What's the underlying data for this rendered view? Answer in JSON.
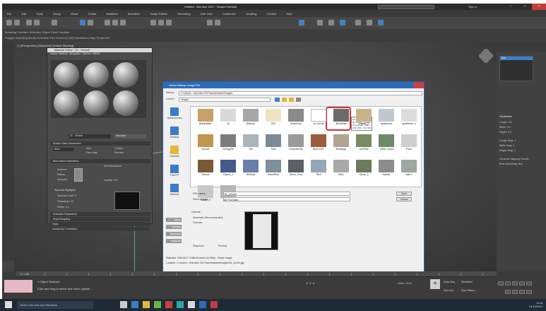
{
  "app": {
    "title": "Untitled - 3ds Max 2017 - Student Version",
    "user": "Sign In",
    "menu": [
      "File",
      "Edit",
      "Tools",
      "Group",
      "Views",
      "Create",
      "Modifiers",
      "Animation",
      "Graph Editors",
      "Rendering",
      "Civil View",
      "Customize",
      "Scripting",
      "Content",
      "Help"
    ],
    "ribbon_row1": "Modeling   Freeform   Selection   Object Paint   Populate",
    "ribbon_row2": "Polygon Modeling   Modify Selection   Edit   Geometry (All)   Subdivision   Align   Properties",
    "viewport_label": "[+] [Perspective] [Standard] [Default Shading]"
  },
  "command_panel": {
    "selected": "Box",
    "params_header": "Parameters",
    "rows": [
      "Length: 0.0",
      "Width: 0.0",
      "Height: 0.0",
      "Length Segs: 1",
      "Width Segs: 1",
      "Height Segs: 1",
      "Generate Mapping Coords.",
      "Real-World Map Size"
    ]
  },
  "material_editor": {
    "title": "Material Editor - 01 - Default",
    "menu": [
      "Modes",
      "Material",
      "Navigation",
      "Options",
      "Utilities"
    ],
    "material_name": "01 - Default",
    "material_type": "Standard",
    "rollouts": [
      "Shader Basic Parameters",
      "Blinn Basic Parameters",
      "Extended Parameters",
      "SuperSampling",
      "Maps",
      "mental ray Connection"
    ],
    "shader": "Blinn",
    "options": [
      "Wire",
      "2-Sided",
      "Face Map",
      "Faceted"
    ],
    "colors": [
      "Ambient:",
      "Diffuse:",
      "Specular:"
    ],
    "self_illum": "Self-Illumination",
    "opacity": "Opacity: 100",
    "spec_header": "Specular Highlights",
    "spec_rows": [
      "Specular Level: 0",
      "Glossiness: 10",
      "Soften: 0.1"
    ]
  },
  "dialog": {
    "title": "Select Bitmap Image File",
    "history_label": "History:",
    "history_value": "C:\\Users\\...\\3ds Max 2017\\sceneassets\\images",
    "lookin_label": "Look in:",
    "lookin_value": "images",
    "places": [
      "Quick access",
      "Desktop",
      "Libraries",
      "This PC",
      "Network"
    ],
    "files": [
      "BumpWall1",
      "LA",
      "Walnut1",
      "002",
      "BrickGrey",
      "15_04190",
      "BrickWall",
      "Carpet_1",
      "apartment",
      "apartment_s",
      "Wood1",
      "CeilingTile",
      "Tile",
      "Tile2",
      "ConcreteTile",
      "Brick DTP",
      "Buildings",
      "ACERAI",
      "TREE round",
      "Floor",
      "Wood2",
      "Carpet_2",
      "Window",
      "StoneBlue",
      "Stone_Grey",
      "Tile3",
      "HALL",
      "Stone_2",
      "Marble",
      "Wall 1",
      "Marble_2",
      "Metal"
    ],
    "selected_file": "15_04190",
    "tooltip": "Item type: JPEG file  Rating: Unrated  Dimensions: 334 x 1517  Size: 79.1 KB",
    "filename_label": "File name:",
    "filename_value": "15_04190",
    "filetype_label": "Files of type:",
    "filetype_value": "All Formats",
    "open_label": "Open",
    "cancel_label": "Cancel",
    "device_label": "Devices",
    "setup_label": "Setup",
    "info_label": "Info",
    "view_label": "View",
    "gamma_header": "Gamma",
    "gamma_opt1": "Automatic (Recommended)",
    "gamma_opt2": "Override",
    "sequence_label": "Sequence",
    "preview_label": "Preview",
    "stats_line1": "Statistics:  334x1517, 8 Bits/Channel (24 Bits) - Single Image",
    "stats_line2": "Location:  C:\\Users\\...\\3ds Max 2017\\sceneassets\\images\\15_04190.jpg"
  },
  "status": {
    "frames": "0 / 100",
    "selection": "1 Object Selected",
    "hint": "Click and drag to select and move objects",
    "coords": "X:    Y:    Z:",
    "grid": "Grid = 10.0",
    "autokey": "Auto Key",
    "selected": "Selected",
    "setkey": "Set Key",
    "keyfilters": "Key Filters..."
  },
  "taskbar": {
    "search": "Search the web and Windows",
    "time": "11:41",
    "date": "01/12/2017"
  }
}
